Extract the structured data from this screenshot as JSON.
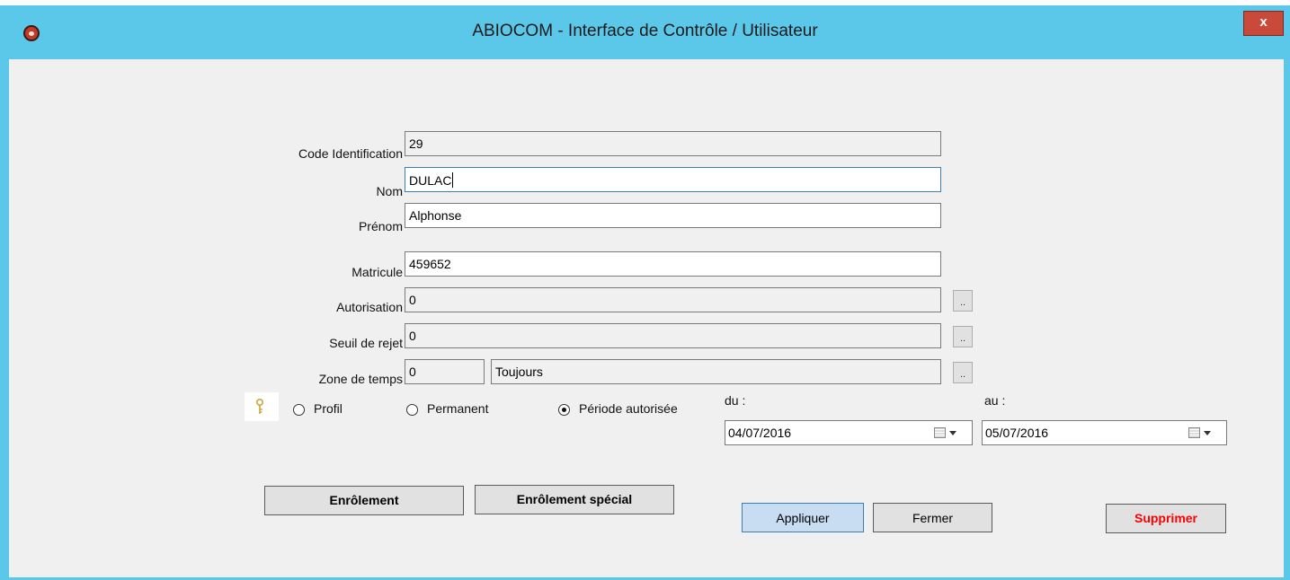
{
  "window": {
    "title": "ABIOCOM - Interface de Contrôle / Utilisateur",
    "close_label": "x"
  },
  "form": {
    "code_label": "Code Identification",
    "code_value": "29",
    "nom_label": "Nom",
    "nom_value": "DULAC",
    "prenom_label": "Prénom",
    "prenom_value": "Alphonse",
    "matricule_label": "Matricule",
    "matricule_value": "459652",
    "autorisation_label": "Autorisation",
    "autorisation_value": "0",
    "seuil_label": "Seuil de rejet",
    "seuil_value": "0",
    "zone_label": "Zone de temps",
    "zone_value": "0",
    "zone_name": "Toujours",
    "browse_label": ".."
  },
  "validity": {
    "options": [
      "Profil",
      "Permanent",
      "Période autorisée"
    ],
    "selected": "Période autorisée",
    "du_label": "du :",
    "du_value": "04/07/2016",
    "au_label": "au :",
    "au_value": "05/07/2016"
  },
  "buttons": {
    "enrolement": "Enrôlement",
    "enrolement_special": "Enrôlement spécial",
    "appliquer": "Appliquer",
    "fermer": "Fermer",
    "supprimer": "Supprimer"
  },
  "colors": {
    "title_bar": "#5bc8ea",
    "close": "#c94a3a",
    "delete_text": "#ff0000"
  }
}
